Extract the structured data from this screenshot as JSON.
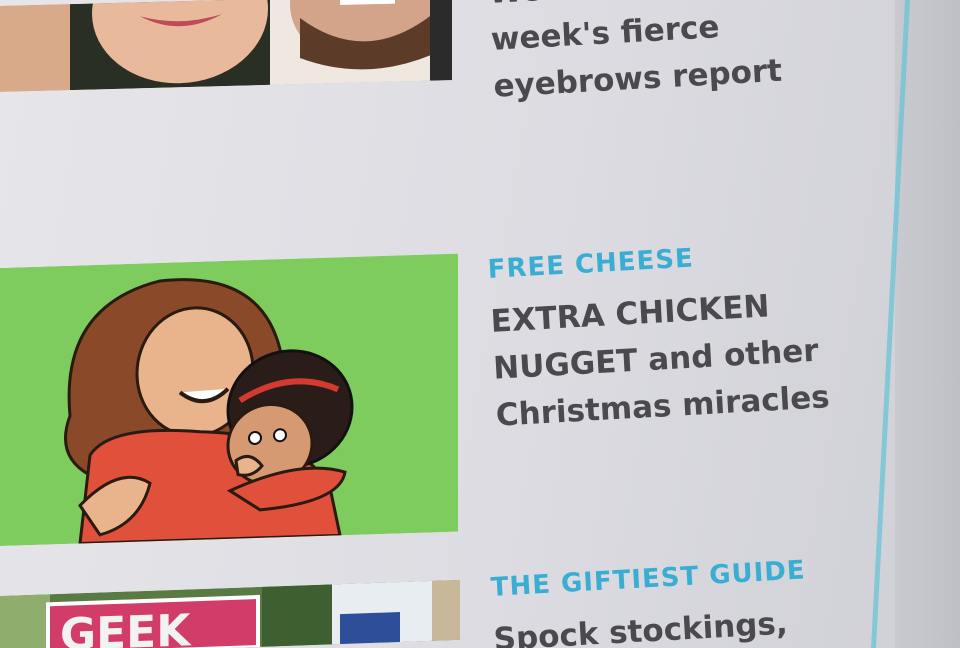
{
  "articles": [
    {
      "category": "",
      "headline_lines": [
        "Welcome to this",
        "week's fierce",
        "eyebrows report"
      ],
      "thumbnail_icon": "faces-photo"
    },
    {
      "category": "FREE CHEESE",
      "headline_lines": [
        "EXTRA CHICKEN",
        "NUGGET and other",
        "Christmas miracles"
      ],
      "thumbnail_icon": "cartoon-mother-hugging-child"
    },
    {
      "category": "THE GIFTIEST GUIDE",
      "headline_lines": [
        "Spock stockings,"
      ],
      "thumbnail_icon": "geek-gift-photo",
      "thumbnail_text": "GEEK"
    }
  ],
  "colors": {
    "category": "#3aaed2",
    "headline": "#4a4a4e",
    "page_edge": "#69c3d6",
    "cartoon_background": "#7ecb5e"
  }
}
